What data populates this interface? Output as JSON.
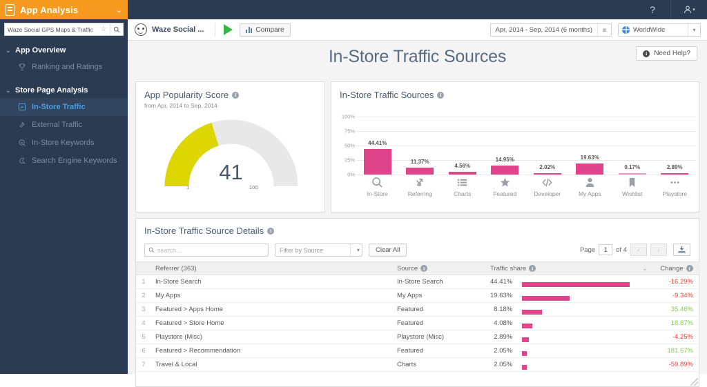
{
  "topbar": {
    "brand": "App Analysis",
    "help_icon": "question-mark-icon",
    "user_icon": "user-icon",
    "chevron": "⌄"
  },
  "sidebar": {
    "app_search": {
      "value": "Waze Social GPS Maps & Traffic",
      "star_icon": "star-icon",
      "search_icon": "search-icon"
    },
    "groups": [
      {
        "label": "App Overview",
        "items": [
          {
            "label": "Ranking and Ratings",
            "icon": "trophy-icon",
            "active": false
          }
        ]
      },
      {
        "label": "Store Page Analysis",
        "items": [
          {
            "label": "In-Store Traffic",
            "icon": "in-store-traffic-icon",
            "active": true
          },
          {
            "label": "External Traffic",
            "icon": "external-traffic-icon",
            "active": false
          },
          {
            "label": "In-Store Keywords",
            "icon": "keyword-magnifier-icon",
            "active": false
          },
          {
            "label": "Search Engine Keywords",
            "icon": "search-engine-icon",
            "active": false
          }
        ]
      }
    ]
  },
  "subbar": {
    "app_name": "Waze Social ...",
    "app_icon": "waze-face-icon",
    "store_icon": "google-play-icon",
    "compare_label": "Compare",
    "compare_icon": "bar-chart-icon",
    "date_range": "Apr, 2014 - Sep, 2014 (6 months)",
    "calendar_icon": "calendar-icon",
    "country": "WorldWide",
    "globe_icon": "globe-icon",
    "dropdown_icon": "chevron-down-icon"
  },
  "page": {
    "title": "In-Store Traffic Sources",
    "need_help": "Need Help?",
    "info_icon": "info-icon"
  },
  "gauge": {
    "title": "App Popularity Score",
    "subtitle": "from Apr, 2014 to Sep, 2014",
    "value": "41",
    "min": "1",
    "max": "100",
    "fill_color": "#ddd600",
    "track_color": "#e8e8e8"
  },
  "sources_card": {
    "title": "In-Store Traffic Sources"
  },
  "chart_data": {
    "type": "bar",
    "title": "In-Store Traffic Sources",
    "xlabel": "",
    "ylabel": "",
    "ylim": [
      0,
      100
    ],
    "yticks": [
      "0%",
      "25%",
      "50%",
      "75%",
      "100%"
    ],
    "ytick_values": [
      0,
      25,
      50,
      75,
      100
    ],
    "grid": true,
    "bar_color": "#e0458c",
    "categories": [
      "In-Store",
      "Referring",
      "Charts",
      "Featured",
      "Developer",
      "My Apps",
      "Wishlist",
      "Playstore"
    ],
    "category_icons": [
      "magnifier-icon",
      "referring-arrows-icon",
      "list-icon",
      "star-icon",
      "code-icon",
      "person-icon",
      "bookmark-icon",
      "ellipsis-icon"
    ],
    "values": [
      44.41,
      11.37,
      4.56,
      14.95,
      2.02,
      19.63,
      0.17,
      2.89
    ],
    "data_labels": [
      "44.41%",
      "11.37%",
      "4.56%",
      "14.95%",
      "2.02%",
      "19.63%",
      "0.17%",
      "2.89%"
    ]
  },
  "details": {
    "title": "In-Store Traffic Source Details",
    "search_placeholder": "search...",
    "search_value": "",
    "filter_placeholder": "Filter by Source",
    "clear_all": "Clear All",
    "page_label": "Page",
    "page_value": "1",
    "page_of": "of 4",
    "prev_icon": "chevron-left-icon",
    "next_icon": "chevron-right-icon",
    "export_icon": "export-icon",
    "columns": [
      "",
      "Referrer (363)",
      "Source",
      "Traffic share",
      "Change"
    ],
    "sort_icon": "chevron-down-icon",
    "rows": [
      {
        "n": "1",
        "referrer": "In-Store Search",
        "source": "In-Store Search",
        "share": "44.41%",
        "share_value": 44.41,
        "change": "-16.29%",
        "dir": "down"
      },
      {
        "n": "2",
        "referrer": "My Apps",
        "source": "My Apps",
        "share": "19.63%",
        "share_value": 19.63,
        "change": "-9.34%",
        "dir": "down"
      },
      {
        "n": "3",
        "referrer": "Featured > Apps Home",
        "source": "Featured",
        "share": "8.18%",
        "share_value": 8.18,
        "change": "35.46%",
        "dir": "up"
      },
      {
        "n": "4",
        "referrer": "Featured > Store Home",
        "source": "Featured",
        "share": "4.08%",
        "share_value": 4.08,
        "change": "18.87%",
        "dir": "up"
      },
      {
        "n": "5",
        "referrer": "Playstore (Misc)",
        "source": "Playstore (Misc)",
        "share": "2.89%",
        "share_value": 2.89,
        "change": "-4.25%",
        "dir": "down"
      },
      {
        "n": "6",
        "referrer": "Featured > Recommendation",
        "source": "Featured",
        "share": "2.05%",
        "share_value": 2.05,
        "change": "181.67%",
        "dir": "up"
      },
      {
        "n": "7",
        "referrer": "Travel & Local",
        "source": "Charts",
        "share": "2.05%",
        "share_value": 2.05,
        "change": "-59.89%",
        "dir": "down"
      }
    ]
  }
}
